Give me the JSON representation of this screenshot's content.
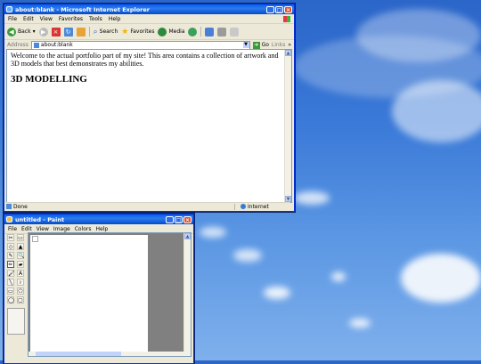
{
  "ie": {
    "title": "about:blank - Microsoft Internet Explorer",
    "menu": [
      "File",
      "Edit",
      "View",
      "Favorites",
      "Tools",
      "Help"
    ],
    "toolbar": {
      "back": "Back",
      "search": "Search",
      "favorites": "Favorites",
      "media": "Media"
    },
    "address_label": "Address",
    "address_value": "about:blank",
    "go": "Go",
    "links": "Links",
    "page": {
      "intro": "Welcome to the actual portfolio part of my site! This area contains a collection of artwork and 3D models that best demonstrates my abilities.",
      "heading": "3D MODELLING"
    },
    "status_left": "Done",
    "status_zone": "Internet"
  },
  "paint": {
    "title": "untitled - Paint",
    "menu": [
      "File",
      "Edit",
      "View",
      "Image",
      "Colors",
      "Help"
    ],
    "tools": [
      "✂",
      "▭",
      "◇",
      "▲",
      "✎",
      "🔍",
      "✏",
      "▰",
      "🖌",
      "A",
      "╲",
      "≀",
      "▭",
      "⬠",
      "◯",
      "▢"
    ]
  }
}
